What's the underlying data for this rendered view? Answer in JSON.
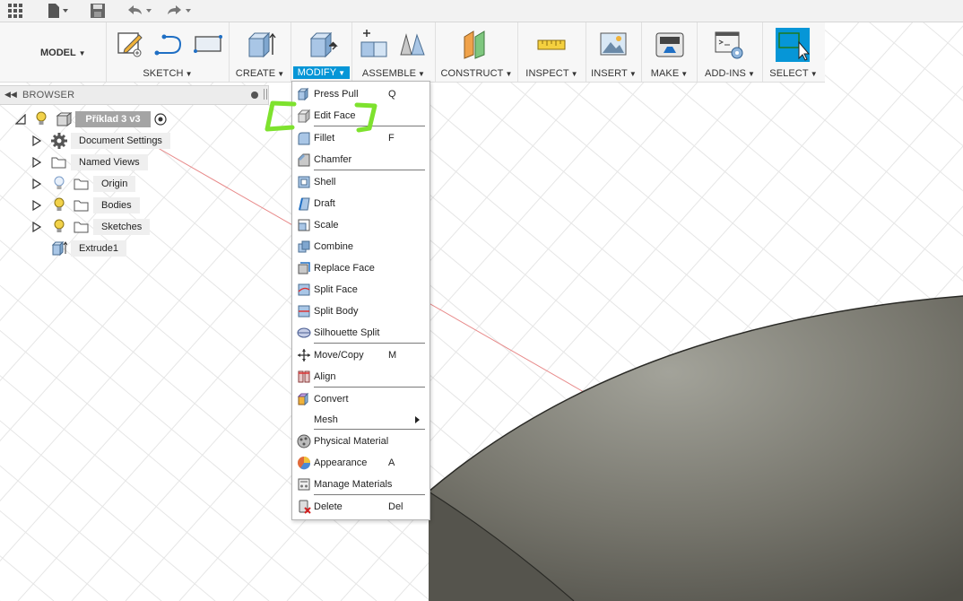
{
  "toolbar": {
    "workspace_label": "MODEL",
    "groups": {
      "sketch": "SKETCH",
      "create": "CREATE",
      "modify": "MODIFY",
      "assemble": "ASSEMBLE",
      "construct": "CONSTRUCT",
      "inspect": "INSPECT",
      "insert": "INSERT",
      "make": "MAKE",
      "addins": "ADD-INS",
      "select": "SELECT"
    }
  },
  "browser": {
    "title": "BROWSER",
    "root": "Příklad 3 v3",
    "items": [
      {
        "label": "Document Settings"
      },
      {
        "label": "Named Views"
      },
      {
        "label": "Origin"
      },
      {
        "label": "Bodies"
      },
      {
        "label": "Sketches"
      },
      {
        "label": "Extrude1"
      }
    ]
  },
  "modify_menu": {
    "items": [
      {
        "label": "Press Pull",
        "shortcut": "Q"
      },
      {
        "label": "Edit Face",
        "shortcut": ""
      },
      {
        "label": "Fillet",
        "shortcut": "F"
      },
      {
        "label": "Chamfer",
        "shortcut": ""
      },
      {
        "label": "Shell",
        "shortcut": ""
      },
      {
        "label": "Draft",
        "shortcut": ""
      },
      {
        "label": "Scale",
        "shortcut": ""
      },
      {
        "label": "Combine",
        "shortcut": ""
      },
      {
        "label": "Replace Face",
        "shortcut": ""
      },
      {
        "label": "Split Face",
        "shortcut": ""
      },
      {
        "label": "Split Body",
        "shortcut": ""
      },
      {
        "label": "Silhouette Split",
        "shortcut": ""
      },
      {
        "label": "Move/Copy",
        "shortcut": "M"
      },
      {
        "label": "Align",
        "shortcut": ""
      },
      {
        "label": "Convert",
        "shortcut": ""
      },
      {
        "label": "Mesh",
        "shortcut": ""
      },
      {
        "label": "Physical Material",
        "shortcut": ""
      },
      {
        "label": "Appearance",
        "shortcut": "A"
      },
      {
        "label": "Manage Materials",
        "shortcut": ""
      },
      {
        "label": "Delete",
        "shortcut": "Del"
      }
    ]
  },
  "colors": {
    "accent": "#0696d7",
    "highlight_annotation": "#7ee22e",
    "body_surface": "#6f6e66"
  }
}
